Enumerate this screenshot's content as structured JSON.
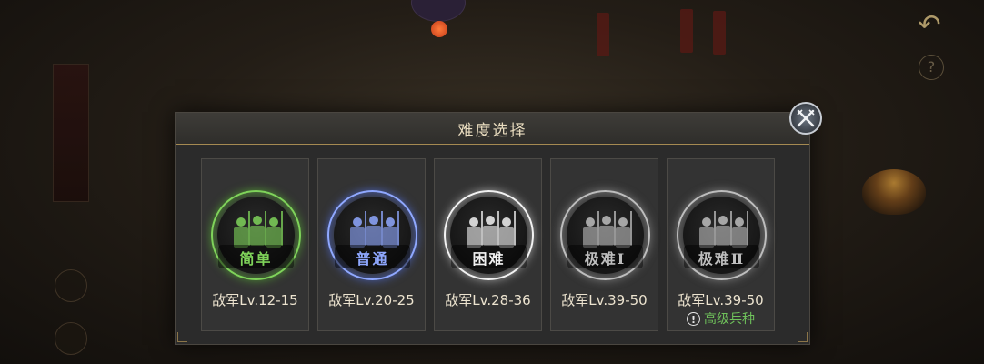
{
  "dialog": {
    "title": "难度选择"
  },
  "difficulties": [
    {
      "label": "简单",
      "level": "敌军Lv.12-15",
      "note": "",
      "color": "#7fd35a",
      "glow": "#4e8f34"
    },
    {
      "label": "普通",
      "level": "敌军Lv.20-25",
      "note": "",
      "color": "#8fa8ff",
      "glow": "#4a5fb0"
    },
    {
      "label": "困难",
      "level": "敌军Lv.28-36",
      "note": "",
      "color": "#f2f2f2",
      "glow": "#9a9a9a"
    },
    {
      "label": "极难Ⅰ",
      "level": "敌军Lv.39-50",
      "note": "",
      "color": "#bdbdbd",
      "glow": "#7a7a7a"
    },
    {
      "label": "极难Ⅱ",
      "level": "敌军Lv.39-50",
      "note": "高级兵种",
      "color": "#bdbdbd",
      "glow": "#7a7a7a"
    }
  ],
  "icons": {
    "close": "crossed-swords-close-icon",
    "back": "back-arrow-icon",
    "help": "question-icon",
    "warning": "exclamation-icon"
  },
  "background": {
    "help_glyph": "?",
    "back_glyph": "↶",
    "warning_glyph": "!"
  }
}
